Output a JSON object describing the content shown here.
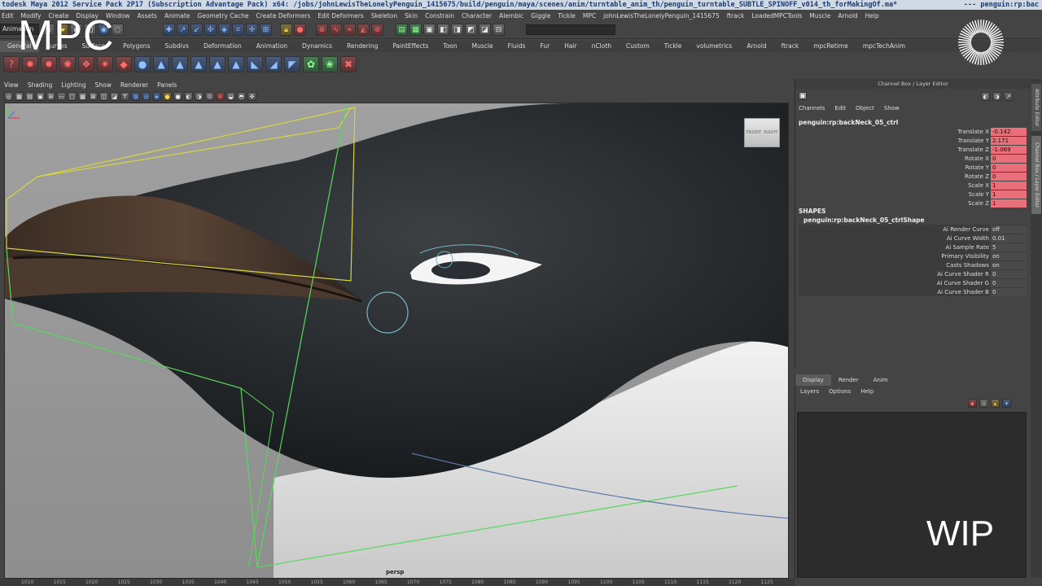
{
  "window": {
    "title": "todesk Maya 2012 Service Pack 2P17 (Subscription Advantage Pack) x64: /jobs/johnLewisTheLonelyPenguin_1415675/build/penguin/maya/scenes/anim/turntable_anim_th/penguin_turntable_SUBTLE_SPINOFF_v014_th_forMakingOf.ma*",
    "title_right": "--- penguin:rp:bac"
  },
  "menubar": [
    "Edit",
    "Modify",
    "Create",
    "Display",
    "Window",
    "Assets",
    "Animate",
    "Geometry Cache",
    "Create Deformers",
    "Edit Deformers",
    "Skeleton",
    "Skin",
    "Constrain",
    "Character",
    "Alembic",
    "Giggle",
    "Tickle",
    "MPC",
    "johnLewisTheLonelyPenguin_1415675",
    "ftrack",
    "LoadedMPCTools",
    "Muscle",
    "Arnold",
    "Help"
  ],
  "statusline": {
    "mode": "Animation"
  },
  "shelf_tabs": [
    "General",
    "Curves",
    "Surfaces",
    "Polygons",
    "Subdivs",
    "Deformation",
    "Animation",
    "Dynamics",
    "Rendering",
    "PaintEffects",
    "Toon",
    "Muscle",
    "Fluids",
    "Fur",
    "Hair",
    "nCloth",
    "Custom",
    "Tickle",
    "volumetrics",
    "Arnold",
    "ftrack",
    "mpcRetime",
    "mpcTechAnim"
  ],
  "panel_menu": [
    "View",
    "Shading",
    "Lighting",
    "Show",
    "Renderer",
    "Panels"
  ],
  "viewport": {
    "camera": "persp",
    "cube_left": "FRONT",
    "cube_right": "RIGHT"
  },
  "time_ruler": [
    "1010",
    "1015",
    "1020",
    "1025",
    "1030",
    "1035",
    "1040",
    "1045",
    "1050",
    "1055",
    "1060",
    "1065",
    "1070",
    "1075",
    "1080",
    "1085",
    "1090",
    "1095",
    "1100",
    "1105",
    "1110",
    "1115",
    "1120",
    "1125"
  ],
  "channel_box": {
    "title": "Channel Box / Layer Editor",
    "menu": [
      "Channels",
      "Edit",
      "Object",
      "Show"
    ],
    "node": "penguin:rp:backNeck_05_ctrl",
    "channels": [
      {
        "label": "Translate X",
        "value": "-0.142"
      },
      {
        "label": "Translate Y",
        "value": "2.171"
      },
      {
        "label": "Translate Z",
        "value": "-1.069"
      },
      {
        "label": "Rotate X",
        "value": "0"
      },
      {
        "label": "Rotate Y",
        "value": "0"
      },
      {
        "label": "Rotate Z",
        "value": "0"
      },
      {
        "label": "Scale X",
        "value": "1"
      },
      {
        "label": "Scale Y",
        "value": "1"
      },
      {
        "label": "Scale Z",
        "value": "1"
      }
    ],
    "shapes_title": "SHAPES",
    "shape_node": "penguin:rp:backNeck_05_ctrlShape",
    "shape_attrs": [
      {
        "label": "Ai Render Curve",
        "value": "off"
      },
      {
        "label": "Ai Curve Width",
        "value": "0.01"
      },
      {
        "label": "Ai Sample Rate",
        "value": "5"
      },
      {
        "label": "Primary Visibility",
        "value": "on"
      },
      {
        "label": "Casts Shadows",
        "value": "on"
      },
      {
        "label": "Ai Curve Shader R",
        "value": "0"
      },
      {
        "label": "Ai Curve Shader G",
        "value": "0"
      },
      {
        "label": "Ai Curve Shader B",
        "value": "0"
      }
    ]
  },
  "layer_editor": {
    "tabs": [
      "Display",
      "Render",
      "Anim"
    ],
    "menu": [
      "Layers",
      "Options",
      "Help"
    ]
  },
  "side_tabs": [
    "Attribute Editor",
    "Channel Box / Layer Editor"
  ],
  "overlay": {
    "logo": "MPC",
    "wip": "WIP"
  },
  "colors": {
    "keyed": "#e96f7a",
    "title_bar": "#cfd9e6",
    "ui_bg": "#444444"
  }
}
